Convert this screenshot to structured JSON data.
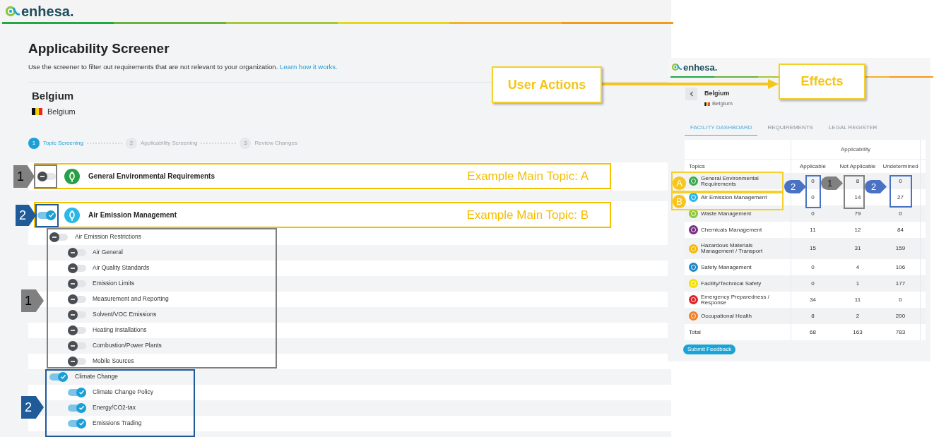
{
  "screener_page": {
    "logo": "enhesa.",
    "title": "Applicability Screener",
    "description": "Use the screener to filter out requirements that are not relevant to your organization.",
    "help_link": "Learn how it works.",
    "facility": {
      "name": "Belgium",
      "country": "Belgium"
    },
    "steps": [
      {
        "number": "1",
        "label": "Topic Screening",
        "selected": true
      },
      {
        "number": "2",
        "label": "Applicability Screening",
        "selected": false
      },
      {
        "number": "3",
        "label": "Review Changes",
        "selected": false
      }
    ],
    "topics": [
      {
        "name": "General Environmental Requirements",
        "on": false,
        "color": "#27a046"
      },
      {
        "name": "Air Emission Management",
        "on": true,
        "color": "#2bb8e8",
        "children": [
          {
            "name": "Air Emission Restrictions",
            "on": false,
            "children": [
              {
                "name": "Air General",
                "on": false
              },
              {
                "name": "Air Quality Standards",
                "on": false
              },
              {
                "name": "Emission Limits",
                "on": false
              },
              {
                "name": "Measurement and Reporting",
                "on": false
              },
              {
                "name": "Solvent/VOC Emissions",
                "on": false
              },
              {
                "name": "Heating Installations",
                "on": false
              },
              {
                "name": "Combustion/Power Plants",
                "on": false
              },
              {
                "name": "Mobile Sources",
                "on": false
              }
            ]
          },
          {
            "name": "Climate Change",
            "on": true,
            "children": [
              {
                "name": "Climate Change Policy",
                "on": true
              },
              {
                "name": "Energy/CO2-tax",
                "on": true
              },
              {
                "name": "Emissions Trading",
                "on": true
              }
            ]
          }
        ]
      }
    ]
  },
  "dashboard_page": {
    "logo": "enhesa.",
    "facility": {
      "name": "Belgium",
      "country": "Belgium"
    },
    "tabs": [
      {
        "label": "FACILITY DASHBOARD",
        "selected": true
      },
      {
        "label": "REQUIREMENTS",
        "selected": false
      },
      {
        "label": "LEGAL REGISTER",
        "selected": false
      }
    ],
    "table": {
      "group_header": "Applicability",
      "columns": [
        "Topics",
        "Applicable",
        "Not Applicable",
        "Undetermined"
      ],
      "rows": [
        {
          "topic": "General Environmental Requirements",
          "color": "#3aa84a",
          "values": [
            "0",
            "8",
            "0"
          ]
        },
        {
          "topic": "Air Emission Management",
          "color": "#29b6e6",
          "values": [
            "0",
            "14",
            "27"
          ]
        },
        {
          "topic": "Waste Management",
          "color": "#8dc63f",
          "values": [
            "0",
            "79",
            "0"
          ]
        },
        {
          "topic": "Chemicals Management",
          "color": "#7b2d83",
          "values": [
            "11",
            "12",
            "84"
          ]
        },
        {
          "topic": "Hazardous Materials Management / Transport",
          "color": "#f5b800",
          "values": [
            "15",
            "31",
            "159"
          ]
        },
        {
          "topic": "Safety Management",
          "color": "#1e88c8",
          "values": [
            "0",
            "4",
            "106"
          ]
        },
        {
          "topic": "Facility/Technical Safety",
          "color": "#f5e100",
          "values": [
            "0",
            "1",
            "177"
          ]
        },
        {
          "topic": "Emergency Preparedness / Response",
          "color": "#e0242b",
          "values": [
            "34",
            "11",
            "0"
          ]
        },
        {
          "topic": "Occupational Health",
          "color": "#f07f22",
          "values": [
            "8",
            "2",
            "200"
          ]
        }
      ],
      "total": {
        "label": "Total",
        "values": [
          "68",
          "163",
          "783"
        ]
      }
    },
    "button": "Submit Feedback"
  },
  "annotations": {
    "user_actions": "User Actions",
    "effects": "Effects",
    "topic_callouts": [
      "Example Main Topic: A",
      "Example Main Topic: B"
    ],
    "action_markers": [
      {
        "label": "1",
        "color": "#808080"
      },
      {
        "label": "2",
        "color": "#1f5a99"
      },
      {
        "label": "1",
        "color": "#808080"
      },
      {
        "label": "2",
        "color": "#1f5a99"
      }
    ],
    "topic_letters": [
      "A",
      "B"
    ],
    "effect_markers": [
      {
        "label": "2",
        "color": "#4a72c4"
      },
      {
        "label": "1",
        "color": "#808080"
      },
      {
        "label": "2",
        "color": "#4a72c4"
      }
    ]
  }
}
